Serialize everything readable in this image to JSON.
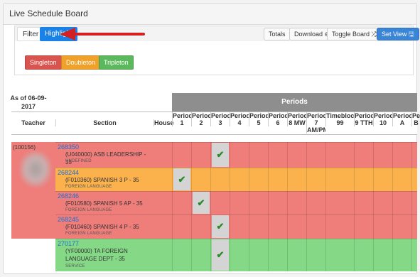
{
  "panel": {
    "title": "Live Schedule Board"
  },
  "tabs": [
    {
      "label": "Filter",
      "active": false
    },
    {
      "label": "Highlight",
      "active": true
    }
  ],
  "toolbar": {
    "totals": "Totals",
    "download": "Download ⊕",
    "toggle_board": "Toggle Board ⤮",
    "set_view": "Set View 🖫"
  },
  "legend": [
    {
      "label": "Singleton",
      "color": "#d9534f"
    },
    {
      "label": "Doubleton",
      "color": "#f0a12a"
    },
    {
      "label": "Tripleton",
      "color": "#5cb85c"
    }
  ],
  "table": {
    "as_of": "As of 06-09-2017",
    "periods_label": "Periods",
    "columns": {
      "teacher": "Teacher",
      "section": "Section",
      "house": "House"
    },
    "periods": [
      {
        "line1": "Period",
        "line2": "1"
      },
      {
        "line1": "Period",
        "line2": "2"
      },
      {
        "line1": "Period",
        "line2": "3"
      },
      {
        "line1": "Period",
        "line2": "4"
      },
      {
        "line1": "Period",
        "line2": "5"
      },
      {
        "line1": "Period",
        "line2": "6"
      },
      {
        "line1": "Period",
        "line2": "8 MW"
      },
      {
        "line1": "Period",
        "line2": "7 AM/PM"
      },
      {
        "line1": "Timeblock",
        "line2": "99"
      },
      {
        "line1": "Period",
        "line2": "9 TTH"
      },
      {
        "line1": "Period",
        "line2": "10"
      },
      {
        "line1": "Period",
        "line2": "A"
      },
      {
        "line1": "Period",
        "line2": "B"
      }
    ],
    "teacher_id": "(100156)",
    "rows": [
      {
        "id": "268350",
        "name": "(U040000) ASB LEADERSHIP - 35",
        "dept": "UNDEFINED",
        "color": "#ef7d7a",
        "period": 3
      },
      {
        "id": "268244",
        "name": "(F010360) SPANISH 3 P - 35",
        "dept": "FOREIGN LANGUAGE",
        "color": "#fbb24c",
        "period": 1
      },
      {
        "id": "268246",
        "name": "(F010580) SPANISH 5 AP - 35",
        "dept": "FOREIGN LANGUAGE",
        "color": "#ef7d7a",
        "period": 2
      },
      {
        "id": "268245",
        "name": "(F010460) SPANISH 4 P - 35",
        "dept": "FOREIGN LANGUAGE",
        "color": "#ef7d7a",
        "period": 3
      },
      {
        "id": "270177",
        "name": "(YF00000) TA FOREIGN LANGUAGE DEPT - 35",
        "dept": "SERVICE",
        "color": "#85d885",
        "period": 3
      }
    ],
    "check_glyph": "✔"
  }
}
